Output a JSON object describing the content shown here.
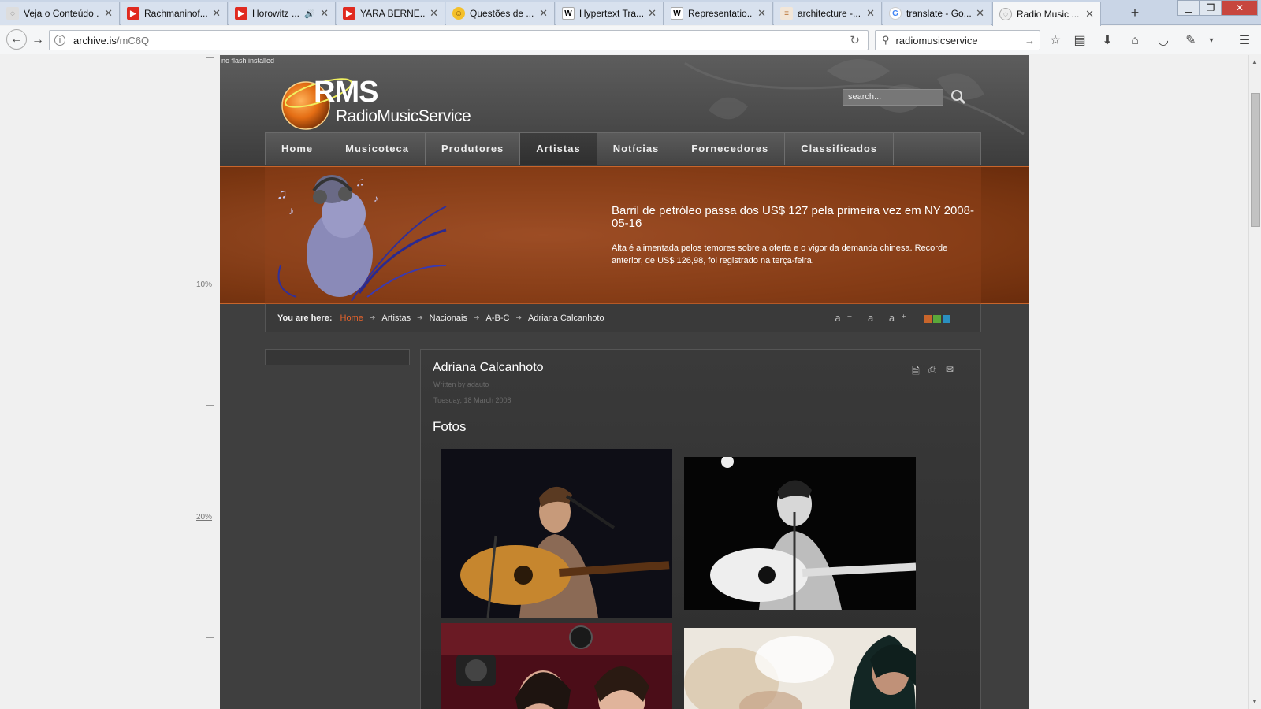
{
  "browser": {
    "tabs": [
      {
        "title": "Veja o Conteúdo ...",
        "icon": "globe-icon"
      },
      {
        "title": "Rachmaninof...",
        "icon": "youtube-icon"
      },
      {
        "title": "Horowitz ...",
        "icon": "youtube-icon",
        "playing_audio": true
      },
      {
        "title": "YARA BERNE...",
        "icon": "youtube-icon"
      },
      {
        "title": "Questões de ...",
        "icon": "smiley-icon"
      },
      {
        "title": "Hypertext Tra...",
        "icon": "wikipedia-icon"
      },
      {
        "title": "Representatio...",
        "icon": "wikipedia-icon"
      },
      {
        "title": "architecture -...",
        "icon": "stackexchange-icon"
      },
      {
        "title": "translate - Go...",
        "icon": "google-icon"
      },
      {
        "title": "Radio Music ...",
        "icon": "globe-icon",
        "active": true
      }
    ],
    "url_host": "archive.is",
    "url_path": "/mC6Q",
    "search_query": "radiomusicservice"
  },
  "archive": {
    "ruler_labels": [
      "10%",
      "20%"
    ]
  },
  "site": {
    "noflash": "no flash installed",
    "logo_mark": "RMS",
    "logo_name": "RadioMusicService",
    "search_placeholder": "search...",
    "nav": [
      "Home",
      "Musicoteca",
      "Produtores",
      "Artistas",
      "Notícias",
      "Fornecedores",
      "Classificados"
    ],
    "nav_active": "Artistas",
    "news": {
      "headline": "Barril de petróleo passa dos US$ 127 pela primeira vez em NY 2008-05-16",
      "body": "Alta é alimentada pelos temores sobre a oferta e o vigor da demanda chinesa. Recorde anterior, de US$ 126,98, foi registrado na terça-feira."
    },
    "breadcrumb": {
      "label": "You are here:",
      "items": [
        "Home",
        "Artistas",
        "Nacionais",
        "A-B-C",
        "Adriana Calcanhoto"
      ]
    },
    "font_controls": [
      "a⁻",
      "a",
      "a⁺"
    ],
    "theme_colors": [
      "#c8652b",
      "#5aa83a",
      "#2a8fc0"
    ],
    "article": {
      "title": "Adriana Calcanhoto",
      "author": "Written by adauto",
      "date": "Tuesday, 18 March 2008",
      "section": "Fotos"
    }
  }
}
